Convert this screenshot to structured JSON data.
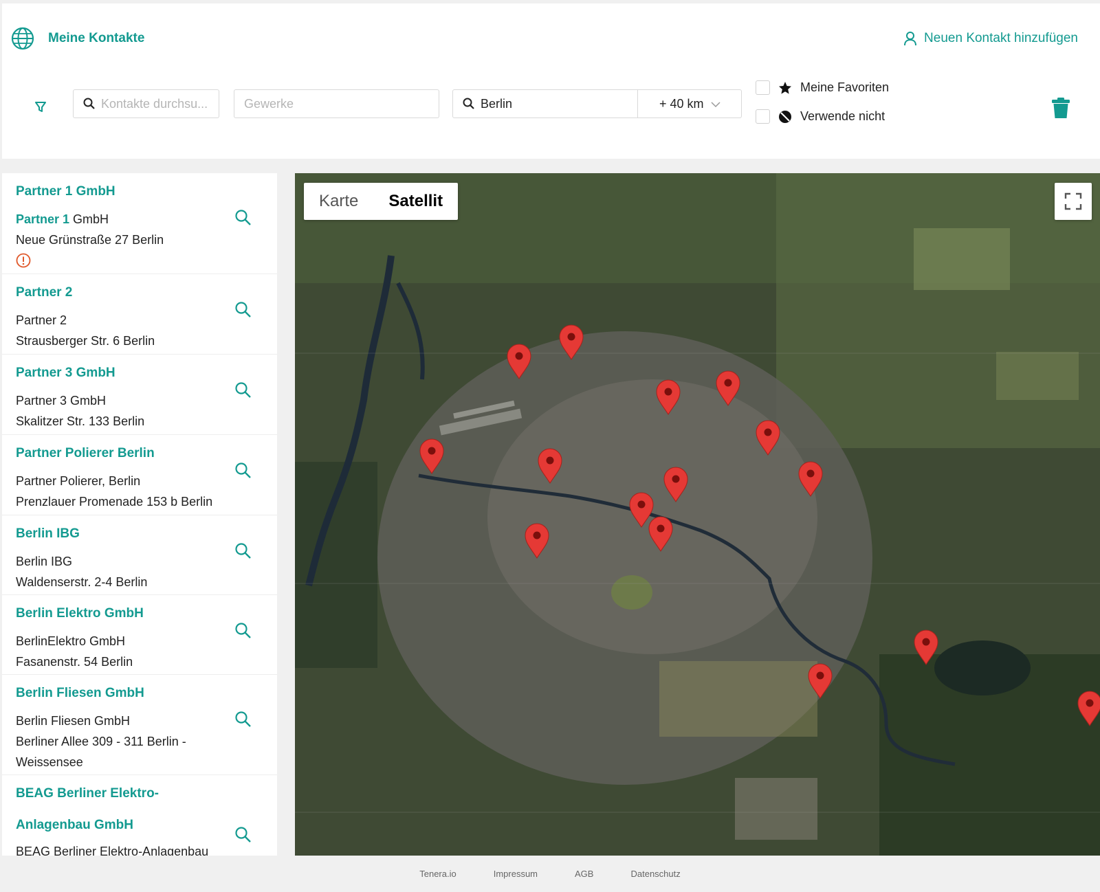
{
  "header": {
    "title": "Meine Kontakte",
    "add_contact_label": "Neuen Kontakt hinzufügen"
  },
  "filters": {
    "search_placeholder": "Kontakte durchsu...",
    "trades_placeholder": "Gewerke",
    "location_value": "Berlin",
    "radius_value": "+ 40 km",
    "favorites_label": "Meine Favoriten",
    "do_not_use_label": "Verwende nicht",
    "favorites_checked": false,
    "do_not_use_checked": false
  },
  "contacts": [
    {
      "title": "Partner 1 GmbH",
      "name_bold": "Partner 1",
      "name_rest": " GmbH",
      "address": "Neue Grünstraße 27 Berlin",
      "warning": true
    },
    {
      "title": "Partner 2",
      "name": "Partner 2",
      "address": "Strausberger Str. 6  Berlin"
    },
    {
      "title": "Partner 3 GmbH",
      "name": "Partner 3 GmbH",
      "address": "Skalitzer Str. 133  Berlin"
    },
    {
      "title": "Partner Polierer Berlin",
      "name": "Partner Polierer, Berlin",
      "address": "Prenzlauer Promenade 153 b Berlin"
    },
    {
      "title": "Berlin IBG",
      "name": "Berlin IBG",
      "address": "Waldenserstr. 2-4  Berlin"
    },
    {
      "title": "Berlin Elektro GmbH",
      "name": "BerlinElektro GmbH",
      "address": "Fasanenstr. 54 Berlin"
    },
    {
      "title": "Berlin Fliesen GmbH",
      "name": "Berlin Fliesen GmbH",
      "address": "Berliner Allee 309 - 311 Berlin - Weissensee"
    },
    {
      "title": "BEAG Berliner Elektro-Anlagenbau GmbH",
      "name": "BEAG Berliner Elektro-Anlagenbau",
      "address": ""
    }
  ],
  "map": {
    "tab_map": "Karte",
    "tab_satellite": "Satellit",
    "active_tab": "Satellit",
    "marker_color": "#e53935"
  },
  "footer": {
    "links": [
      "Tenera.io",
      "Impressum",
      "AGB",
      "Datenschutz"
    ]
  },
  "colors": {
    "accent": "#139a90"
  }
}
